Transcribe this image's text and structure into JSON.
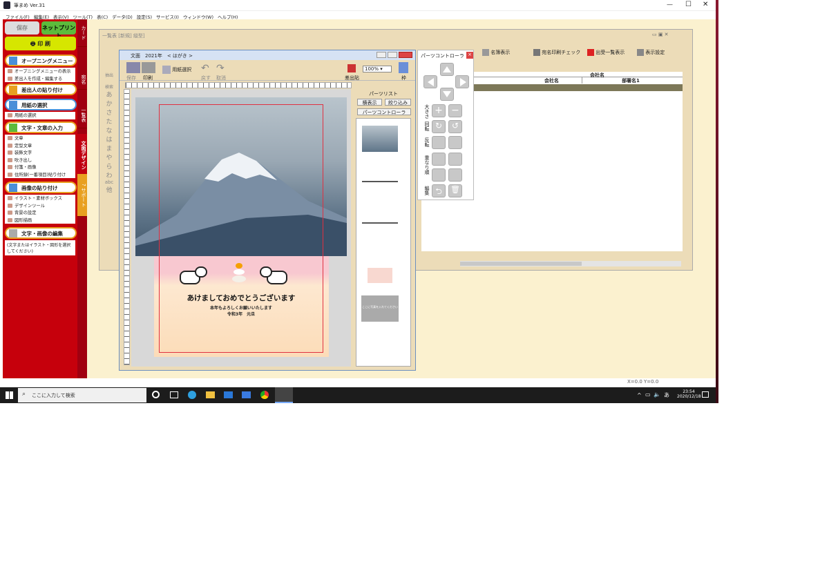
{
  "app": {
    "title": "筆まめ Ver.31"
  },
  "menu": [
    "ファイル(F)",
    "編集(E)",
    "表示(V)",
    "ツール(T)",
    "表(C)",
    "データ(D)",
    "設定(S)",
    "サービス(I)",
    "ウィンドウ(W)",
    "ヘルプ(H)"
  ],
  "sidebar": {
    "save": "保存",
    "net_print": "ネットプリント",
    "print": "印 刷",
    "opening": {
      "label": "オープニングメニュー",
      "items": [
        "オープニングメニューの表示",
        "差出人を作成・編集する"
      ]
    },
    "sender": "差出人の貼り付け",
    "paper": {
      "label": "用紙の選択",
      "items": [
        "用紙の選択"
      ]
    },
    "text": {
      "label": "文字・文章の入力",
      "items": [
        "文章",
        "定型文章",
        "装飾文字",
        "吹き出し",
        "付箋・画像",
        "住所録(一番項目)貼り付け"
      ]
    },
    "image": {
      "label": "画像の貼り付け",
      "items": [
        "イラスト・素材ボックス",
        "デザインツール",
        "背景の設定",
        "図形描画"
      ]
    },
    "edit": {
      "label": "文字・画像の編集",
      "hint": "(文字またはイラスト・図形を選択してください)"
    }
  },
  "tabs": [
    "カード",
    "宛名",
    "一覧表",
    "文面デザイン",
    "サポート"
  ],
  "bgwin": {
    "title": "一覧表 [新規] 縦型]",
    "toolbar": [
      "名簿表示",
      "宛名印刷チェック",
      "出受一覧表示",
      "表示設定"
    ],
    "table_header_group": "会社名",
    "columns": [
      "会社名",
      "部署名1"
    ],
    "coords": "X=0.0 Y=0.0"
  },
  "docwin": {
    "title": "文面",
    "year": "2021年",
    "type": "< はがき >",
    "paper_select": "用紙選択",
    "zoom": "100%",
    "sender_paste": "差出貼",
    "frame": "枠",
    "buttons": [
      "保存",
      "印刷",
      "戻す",
      "取消"
    ]
  },
  "kana": [
    "あ",
    "か",
    "さ",
    "た",
    "な",
    "は",
    "ま",
    "や",
    "ら",
    "わ",
    "abc",
    "他"
  ],
  "kana_header": [
    "抽出",
    "検索"
  ],
  "card": {
    "greeting": "あけましておめでとうございます",
    "line2": "本年もよろしくお願いいたします",
    "line3": "令和3年　元旦"
  },
  "partslist": {
    "title": "パーツリスト",
    "btn1": "横表示",
    "btn2": "絞り込み",
    "btn3": "パーツコントローラ",
    "thumb_text": "ここに写真を入れてください"
  },
  "pctrl": {
    "title": "パーツコントローラ",
    "labels": [
      "大きさ",
      "回転",
      "反転",
      "重なり順",
      "編集"
    ]
  },
  "taskbar": {
    "search": "ここに入力して検索",
    "time": "23:54",
    "date": "2020/12/18",
    "ime": "あ"
  }
}
